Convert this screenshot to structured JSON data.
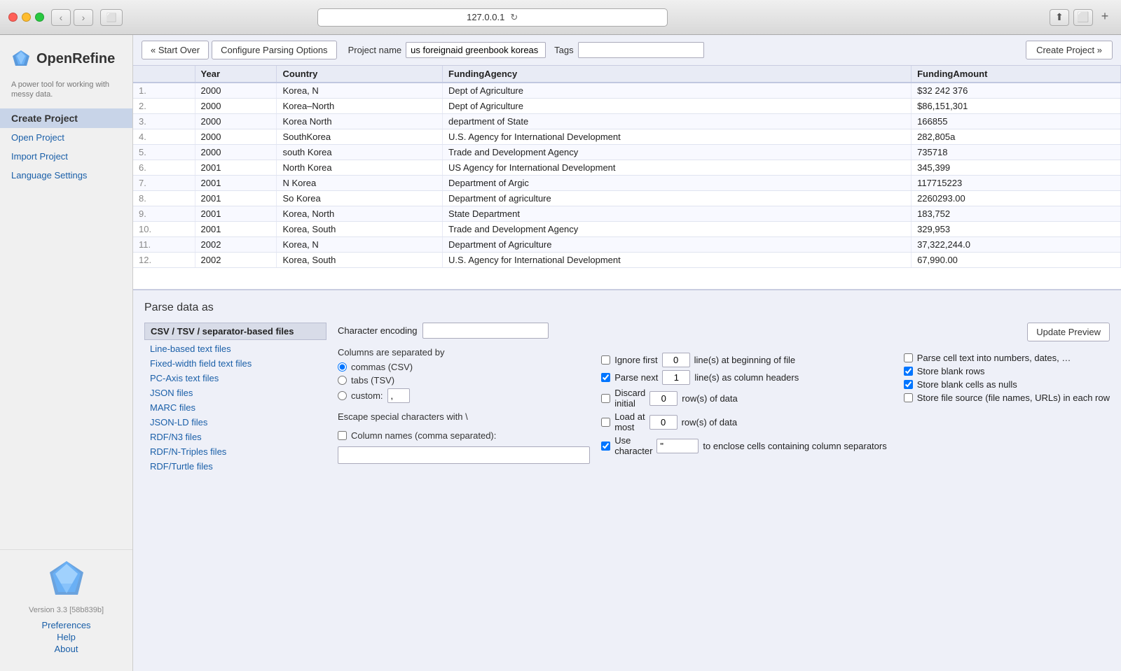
{
  "browser": {
    "address": "127.0.0.1",
    "reload_symbol": "↻",
    "back_symbol": "‹",
    "forward_symbol": "›"
  },
  "app": {
    "logo_text": "OpenRefine",
    "tagline": "A power tool for working with messy data.",
    "version": "Version 3.3 [58b839b]"
  },
  "sidebar": {
    "items": [
      {
        "id": "create-project",
        "label": "Create Project",
        "active": true
      },
      {
        "id": "open-project",
        "label": "Open Project",
        "active": false
      },
      {
        "id": "import-project",
        "label": "Import Project",
        "active": false
      },
      {
        "id": "language-settings",
        "label": "Language Settings",
        "active": false
      }
    ],
    "links": [
      {
        "id": "preferences",
        "label": "Preferences"
      },
      {
        "id": "help",
        "label": "Help"
      },
      {
        "id": "about",
        "label": "About"
      }
    ]
  },
  "toolbar": {
    "start_over_label": "« Start Over",
    "configure_label": "Configure Parsing Options",
    "project_name_label": "Project name",
    "project_name_value": "us foreignaid greenbook koreas cs'",
    "tags_label": "Tags",
    "tags_value": "",
    "create_project_label": "Create Project »"
  },
  "table": {
    "headers": [
      "",
      "Year",
      "Country",
      "FundingAgency",
      "FundingAmount"
    ],
    "rows": [
      [
        "1.",
        "2000",
        "Korea, N",
        "Dept of Agriculture",
        "$32 242 376"
      ],
      [
        "2.",
        "2000",
        "Korea–North",
        "Dept of Agriculture",
        "$86,151,301"
      ],
      [
        "3.",
        "2000",
        "Korea North",
        "department of State",
        "166855"
      ],
      [
        "4.",
        "2000",
        "SouthKorea",
        "U.S. Agency for International Development",
        "282,805a"
      ],
      [
        "5.",
        "2000",
        "south Korea",
        "Trade and Development Agency",
        "735718"
      ],
      [
        "6.",
        "2001",
        "North Korea",
        "US Agency for International Development",
        "345,399"
      ],
      [
        "7.",
        "2001",
        "N Korea",
        "Department of Argic",
        "117715223"
      ],
      [
        "8.",
        "2001",
        "So Korea",
        "Department of agriculture",
        "2260293.00"
      ],
      [
        "9.",
        "2001",
        "Korea, North",
        "State Department",
        "183,752"
      ],
      [
        "10.",
        "2001",
        "Korea, South",
        "Trade and Development Agency",
        "329,953"
      ],
      [
        "11.",
        "2002",
        "Korea, N",
        "Department of Agriculture",
        "37,322,244.0"
      ],
      [
        "12.",
        "2002",
        "Korea, South",
        "U.S. Agency for International Development",
        "67,990.00"
      ]
    ]
  },
  "parse": {
    "title": "Parse data as",
    "section_title": "CSV / TSV / separator-based files",
    "file_types": [
      "Line-based text files",
      "Fixed-width field text files",
      "PC-Axis text files",
      "JSON files",
      "MARC files",
      "JSON-LD files",
      "RDF/N3 files",
      "RDF/N-Triples files",
      "RDF/Turtle files"
    ],
    "char_encoding_label": "Character encoding",
    "char_encoding_value": "",
    "separator_label": "Columns are separated by",
    "separator_options": [
      {
        "id": "commas",
        "label": "commas (CSV)",
        "checked": true
      },
      {
        "id": "tabs",
        "label": "tabs (TSV)",
        "checked": false
      },
      {
        "id": "custom",
        "label": "custom:",
        "checked": false
      }
    ],
    "custom_value": ",",
    "escape_label": "Escape special characters with \\",
    "update_preview_label": "Update Preview",
    "options": {
      "ignore_first_label": "Ignore first",
      "ignore_first_value": "0",
      "ignore_first_suffix": "line(s) at beginning of file",
      "parse_next_label": "Parse next",
      "parse_next_value": "1",
      "parse_next_suffix": "line(s) as column headers",
      "discard_initial_label": "Discard initial",
      "discard_initial_value": "0",
      "discard_initial_suffix": "row(s) of data",
      "load_at_most_label": "Load at most",
      "load_at_most_value": "0",
      "load_at_most_suffix": "row(s) of data",
      "use_character_label": "Use character",
      "use_character_value": "\"",
      "use_character_suffix": "to enclose cells containing column separators"
    },
    "col_names_label": "Column names (comma separated):",
    "col_names_value": "",
    "parse_cell_label": "Parse cell text into numbers, dates, …",
    "store_blank_rows_label": "Store blank rows",
    "store_blank_cells_label": "Store blank cells as nulls",
    "store_file_source_label": "Store file source (file names, URLs) in each row"
  }
}
